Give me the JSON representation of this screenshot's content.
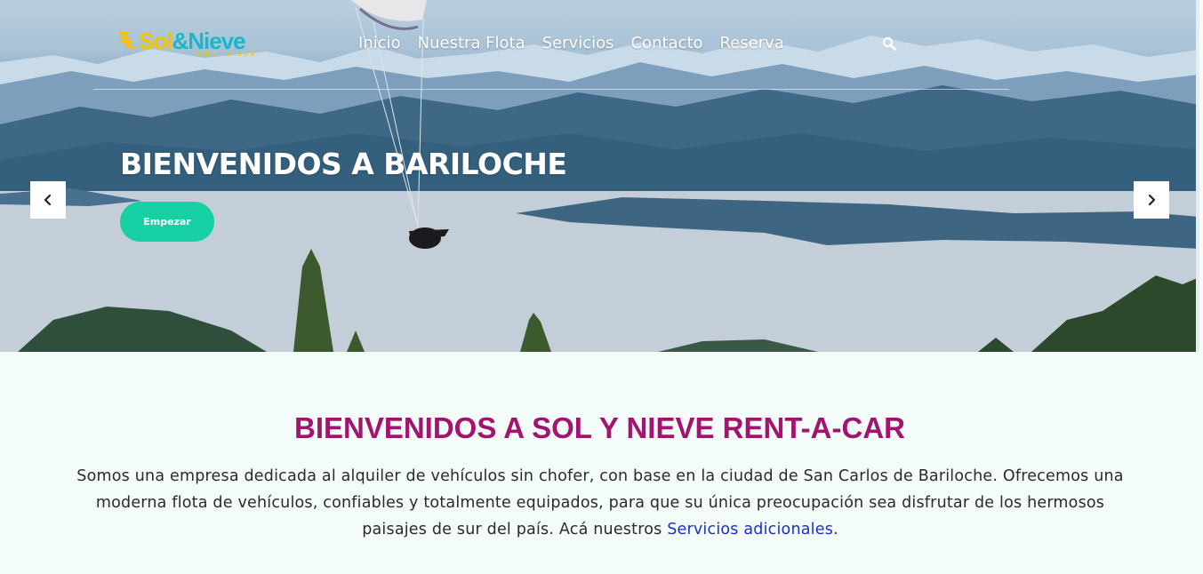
{
  "brand": {
    "name_part1": "Sol",
    "name_amp": "&",
    "name_part2": "Nieve",
    "tagline": "RENT-A-CAR",
    "colors": {
      "yellow": "#f2c300",
      "teal": "#18b7c9"
    }
  },
  "nav": {
    "items": [
      "Inicio",
      "Nuestra Flota",
      "Servicios",
      "Contacto",
      "Reserva"
    ],
    "search_icon": "search-icon"
  },
  "hero": {
    "title": "BIENVENIDOS A BARILOCHE",
    "cta_label": "Empezar",
    "cta_color": "#17d0a4",
    "prev_icon": "chevron-left-icon",
    "next_icon": "chevron-right-icon"
  },
  "welcome": {
    "title": "BIENVENIDOS A SOL Y NIEVE RENT-A-CAR",
    "title_color": "#a3146e",
    "text": "Somos una empresa dedicada al alquiler de vehículos sin chofer, con base en la ciudad de San Carlos de Bariloche. Ofrecemos una moderna flota de vehículos, confiables y totalmente equipados, para que su única preocupación sea disfrutar de los hermosos paisajes de sur del país. Acá nuestros",
    "link_text": "Servicios adicionales",
    "text_end": "."
  }
}
